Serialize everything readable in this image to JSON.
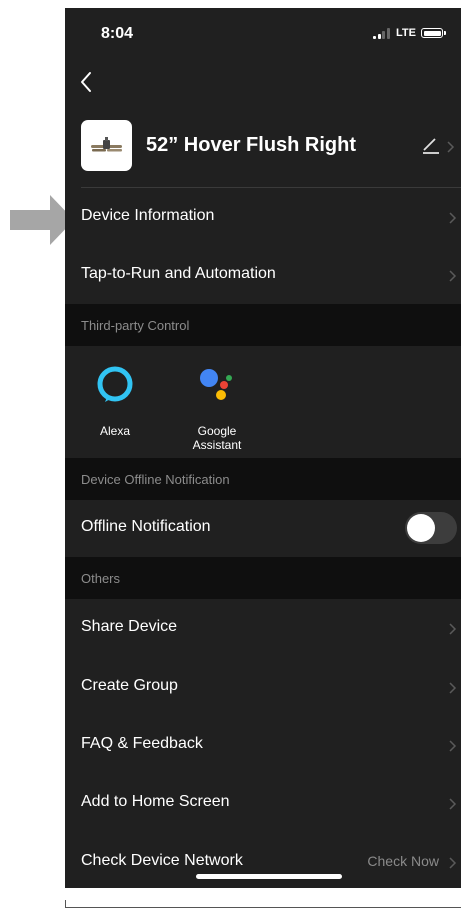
{
  "status_bar": {
    "time": "8:04",
    "network": "LTE"
  },
  "device": {
    "name": "52” Hover Flush Right"
  },
  "rows": {
    "device_information": "Device Information",
    "tap_to_run": "Tap-to-Run and Automation",
    "offline_notification": "Offline Notification",
    "share_device": "Share Device",
    "create_group": "Create Group",
    "faq_feedback": "FAQ & Feedback",
    "add_to_home": "Add to Home Screen",
    "check_network": "Check Device Network",
    "check_now": "Check Now"
  },
  "sections": {
    "third_party": "Third-party Control",
    "offline": "Device Offline Notification",
    "others": "Others"
  },
  "third_party": {
    "alexa": "Alexa",
    "google": "Google Assistant"
  },
  "toggles": {
    "offline_notification_on": false
  },
  "icons": [
    "back-icon",
    "edit-icon",
    "chevron-right-icon",
    "alexa-icon",
    "google-assistant-icon"
  ],
  "colors": {
    "background": "#202020",
    "section": "#0f0f0f",
    "alexa": "#31c4f3"
  }
}
